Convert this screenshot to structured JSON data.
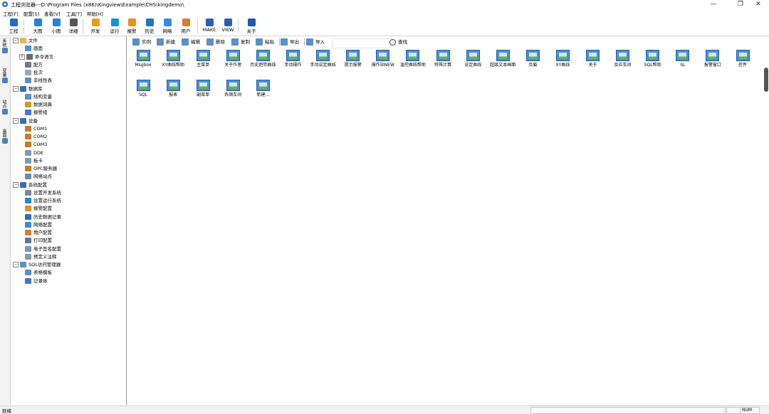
{
  "window": {
    "title": "工程浏览器---D:\\Program Files (x86)\\Kingview\\Example\\CHS\\kingdemo\\",
    "minimize": "—",
    "maximize": "❐",
    "close": "✕"
  },
  "menu": [
    "工程[F]",
    "配置[S]",
    "查看[V]",
    "工具[T]",
    "帮助[H]"
  ],
  "toolbar": [
    {
      "label": "工程",
      "icon": "project-icon",
      "color": "#1e6fc4"
    },
    {
      "label": "大图",
      "icon": "large-icons-icon",
      "color": "#2d7fd2"
    },
    {
      "label": "小图",
      "icon": "small-icons-icon",
      "color": "#2d7fd2"
    },
    {
      "label": "详细",
      "icon": "details-icon",
      "color": "#555555"
    },
    {
      "label": "开发",
      "icon": "develop-icon",
      "color": "#e0a020"
    },
    {
      "label": "运行",
      "icon": "run-icon",
      "color": "#1a8fd0"
    },
    {
      "label": "报警",
      "icon": "alarm-icon",
      "color": "#e89020"
    },
    {
      "label": "历史",
      "icon": "history-icon",
      "color": "#2a6fc0"
    },
    {
      "label": "网络",
      "icon": "network-icon",
      "color": "#3a8ad8"
    },
    {
      "label": "用户",
      "icon": "user-icon",
      "color": "#d08030"
    },
    {
      "label": "MAKE",
      "icon": "make-icon",
      "color": "#2a5fb0"
    },
    {
      "label": "VIEW",
      "icon": "view-icon",
      "color": "#2a5fb0"
    },
    {
      "label": "关于",
      "icon": "about-icon",
      "color": "#1e5aa8"
    }
  ],
  "side_tabs": [
    {
      "label": "系统",
      "icon": "system-tab-icon"
    },
    {
      "label": "变量",
      "icon": "variable-tab-icon"
    },
    {
      "label": "站点",
      "icon": "station-tab-icon"
    },
    {
      "label": "画面",
      "icon": "screen-tab-icon"
    }
  ],
  "tree": [
    {
      "label": "文件",
      "level": 0,
      "exp": "⊟",
      "icon": "folder-icon",
      "color": "#e8b84a"
    },
    {
      "label": "画面",
      "level": 1,
      "exp": "",
      "icon": "screen-icon",
      "color": "#4a90d9"
    },
    {
      "label": "命令语言",
      "level": 1,
      "exp": "⊞",
      "icon": "command-language-icon",
      "color": "#6a6a6a"
    },
    {
      "label": "配方",
      "level": 1,
      "exp": "",
      "icon": "recipe-icon",
      "color": "#7a7a7a"
    },
    {
      "label": "批次",
      "level": 1,
      "exp": "",
      "icon": "batch-icon",
      "color": "#9ab"
    },
    {
      "label": "非线性表",
      "level": 1,
      "exp": "",
      "icon": "nonlinear-table-icon",
      "color": "#5a8fc8"
    },
    {
      "label": "数据库",
      "level": 0,
      "exp": "⊟",
      "icon": "database-icon",
      "color": "#3a6fb0"
    },
    {
      "label": "结构变量",
      "level": 1,
      "exp": "",
      "icon": "struct-variable-icon",
      "color": "#5a8fc8"
    },
    {
      "label": "数据词典",
      "level": 1,
      "exp": "",
      "icon": "data-dictionary-icon",
      "color": "#c8a020"
    },
    {
      "label": "报警组",
      "level": 1,
      "exp": "",
      "icon": "alarm-group-icon",
      "color": "#3a7ad0"
    },
    {
      "label": "设备",
      "level": 0,
      "exp": "⊟",
      "icon": "device-icon",
      "color": "#3a6fb0"
    },
    {
      "label": "COM1",
      "level": 1,
      "exp": "",
      "icon": "com-port-icon",
      "color": "#d07a20"
    },
    {
      "label": "COM2",
      "level": 1,
      "exp": "",
      "icon": "com-port-icon",
      "color": "#d07a20"
    },
    {
      "label": "COM3",
      "level": 1,
      "exp": "",
      "icon": "com-port-icon",
      "color": "#d07a20"
    },
    {
      "label": "DDE",
      "level": 1,
      "exp": "",
      "icon": "dde-icon",
      "color": "#7a9ab8"
    },
    {
      "label": "板卡",
      "level": 1,
      "exp": "",
      "icon": "board-card-icon",
      "color": "#7a9ab8"
    },
    {
      "label": "OPC服务器",
      "level": 1,
      "exp": "",
      "icon": "opc-server-icon",
      "color": "#d07a20"
    },
    {
      "label": "网络站点",
      "level": 1,
      "exp": "",
      "icon": "network-station-icon",
      "color": "#6a8aa8"
    },
    {
      "label": "系统配置",
      "level": 0,
      "exp": "⊟",
      "icon": "system-config-icon",
      "color": "#3a6fb0"
    },
    {
      "label": "设置开发系统",
      "level": 1,
      "exp": "",
      "icon": "dev-system-icon",
      "color": "#7a8a9a"
    },
    {
      "label": "设置运行系统",
      "level": 1,
      "exp": "",
      "icon": "run-system-icon",
      "color": "#1a8fd0"
    },
    {
      "label": "报警配置",
      "level": 1,
      "exp": "",
      "icon": "alarm-config-icon",
      "color": "#e89020"
    },
    {
      "label": "历史数据记录",
      "level": 1,
      "exp": "",
      "icon": "history-record-icon",
      "color": "#2a6fc0"
    },
    {
      "label": "网络配置",
      "level": 1,
      "exp": "",
      "icon": "network-config-icon",
      "color": "#3a8ad8"
    },
    {
      "label": "用户配置",
      "level": 1,
      "exp": "",
      "icon": "user-config-icon",
      "color": "#d08030"
    },
    {
      "label": "打印配置",
      "level": 1,
      "exp": "",
      "icon": "print-config-icon",
      "color": "#5a7a9a"
    },
    {
      "label": "电子签名配置",
      "level": 1,
      "exp": "",
      "icon": "e-signature-icon",
      "color": "#6a9ad0"
    },
    {
      "label": "预定义注释",
      "level": 1,
      "exp": "",
      "icon": "predefined-note-icon",
      "color": "#8a9aaa"
    },
    {
      "label": "SQL访问管理器",
      "level": 0,
      "exp": "⊟",
      "icon": "sql-manager-icon",
      "color": "#5a8fc8"
    },
    {
      "label": "表格模板",
      "level": 1,
      "exp": "",
      "icon": "table-template-icon",
      "color": "#5a8fc8"
    },
    {
      "label": "记录体",
      "level": 1,
      "exp": "",
      "icon": "record-body-icon",
      "color": "#3a7ad0"
    }
  ],
  "subtoolbar": [
    {
      "label": "实例",
      "icon": "instance-icon",
      "color": "#5a8fc8"
    },
    {
      "label": "新建",
      "icon": "new-icon",
      "color": "#5a8fc8"
    },
    {
      "label": "编辑",
      "icon": "edit-icon",
      "color": "#5a8fc8"
    },
    {
      "label": "删除",
      "icon": "delete-icon",
      "color": "#5a8fc8"
    },
    {
      "label": "复制",
      "icon": "copy-icon",
      "color": "#5a8fc8"
    },
    {
      "label": "粘贴",
      "icon": "paste-icon",
      "color": "#5a8fc8"
    },
    {
      "label": "导出",
      "icon": "export-icon",
      "color": "#5a8fc8"
    },
    {
      "label": "导入",
      "icon": "import-icon",
      "color": "#5a8fc8"
    }
  ],
  "filter_value": "",
  "search": {
    "label": "查找",
    "icon": "search-icon"
  },
  "tiles": [
    "Msgbox",
    "XY曲线帮助",
    "主菜单",
    "关于作者",
    "历史趋势曲线",
    "手动操作",
    "手动设定曲线",
    "提示报警",
    "操作站NEW",
    "温控曲线帮助",
    "特殊计算",
    "设定曲线",
    "超级文本画面",
    "页眉",
    "XY曲线",
    "关于",
    "反应车间",
    "SQL帮助",
    "SL",
    "报警窗口",
    "控件",
    "SQL",
    "报表",
    "副菜单",
    "炼钢车间",
    "新建..."
  ],
  "status": {
    "text": "就绪",
    "num": "NUM"
  }
}
